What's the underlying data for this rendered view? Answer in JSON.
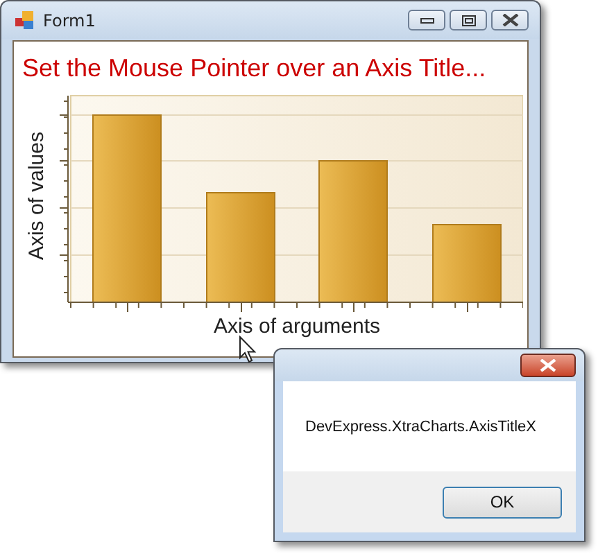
{
  "main_window": {
    "title": "Form1",
    "heading": "Set the Mouse Pointer over an Axis Title...",
    "chart": {
      "y_axis_title": "Axis of values",
      "x_axis_title": "Axis of arguments"
    }
  },
  "message_box": {
    "message": "DevExpress.XtraCharts.AxisTitleX",
    "buttons": [
      "OK"
    ]
  }
}
